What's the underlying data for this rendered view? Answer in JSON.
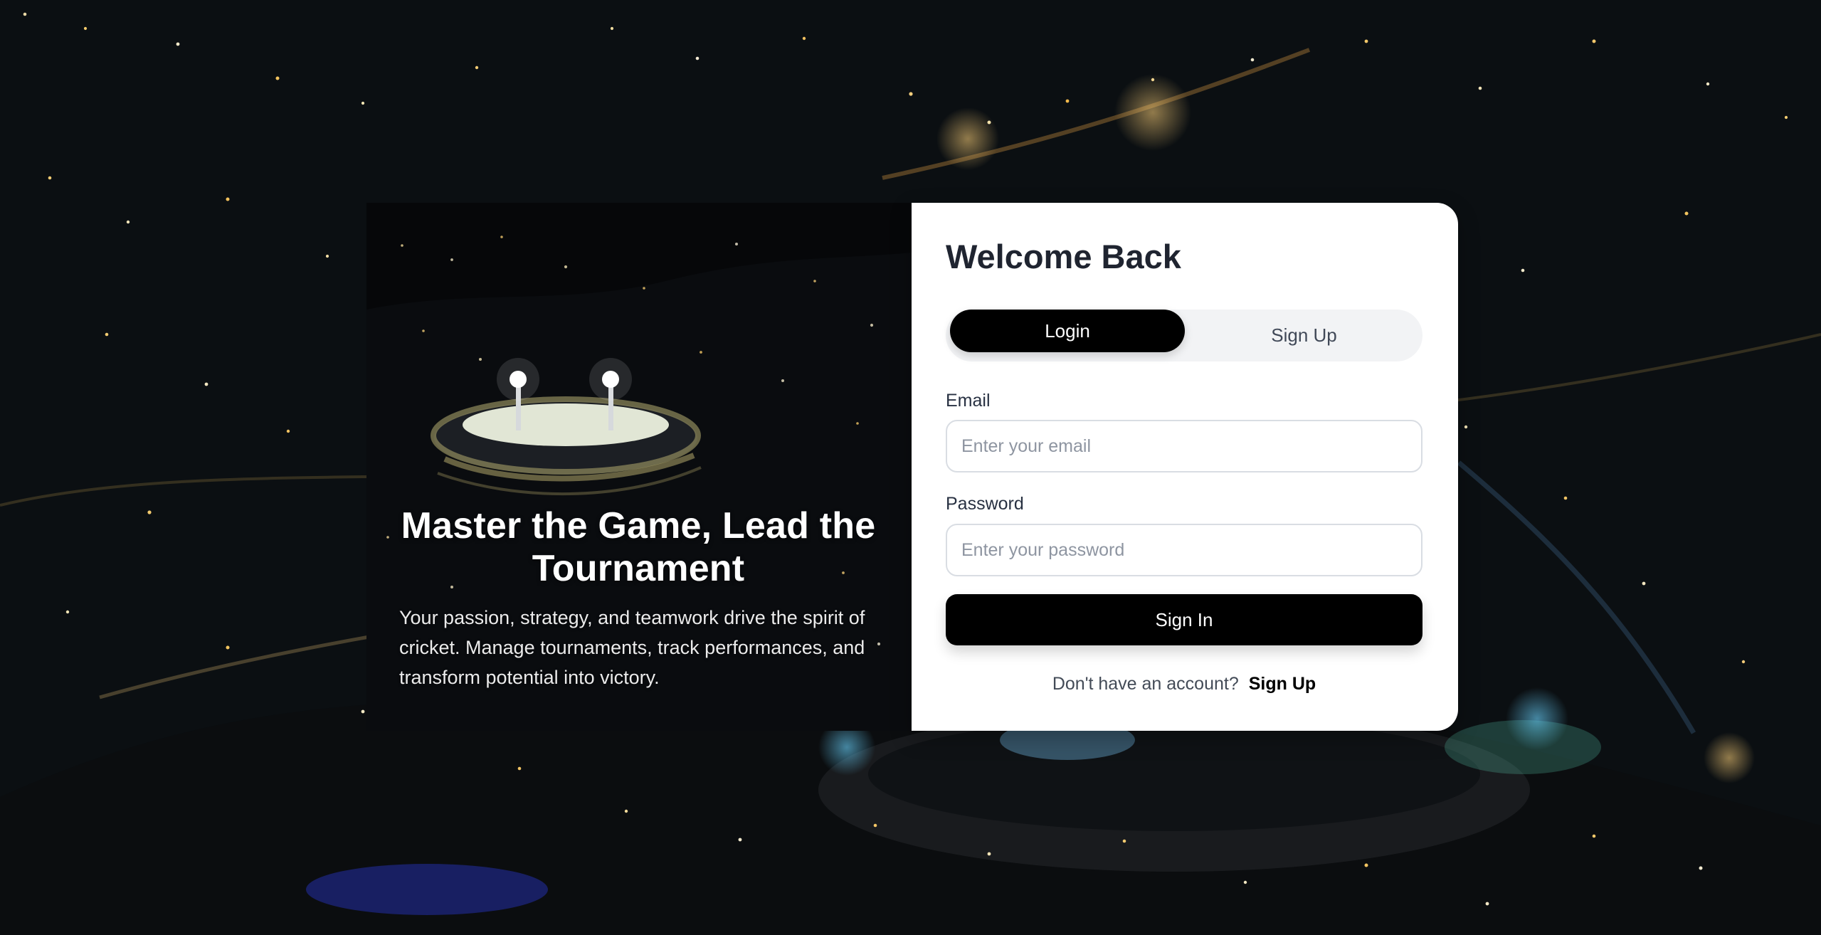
{
  "hero": {
    "title": "Master the Game, Lead the Tournament",
    "description": "Your passion, strategy, and teamwork drive the spirit of cricket. Manage tournaments, track performances, and transform potential into victory."
  },
  "login_card": {
    "title": "Welcome Back",
    "tabs": {
      "login": "Login",
      "signup": "Sign Up"
    },
    "email": {
      "label": "Email",
      "placeholder": "Enter your email",
      "value": ""
    },
    "password": {
      "label": "Password",
      "placeholder": "Enter your password",
      "value": ""
    },
    "signin_button": "Sign In",
    "signup_prompt": "Don't have an account?",
    "signup_link": "Sign Up"
  },
  "colors": {
    "card_background": "#ffffff",
    "primary_black": "#000000",
    "text_dark": "#1f2430",
    "muted_text": "#8e95a1",
    "toggle_background": "#f2f3f5"
  }
}
